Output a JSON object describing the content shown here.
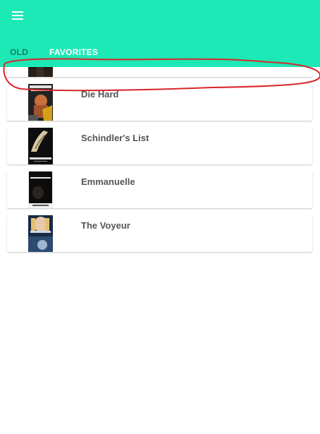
{
  "appbar": {
    "color": "#1de9b6",
    "menu_icon": "hamburger-menu-icon",
    "tabs": [
      {
        "label": "OLD",
        "selected": false
      },
      {
        "label": "FAVORITES",
        "selected": true
      }
    ]
  },
  "movies": [
    {
      "title": ""
    },
    {
      "title": "Die Hard"
    },
    {
      "title": "Schindler's List"
    },
    {
      "title": "Emmanuelle"
    },
    {
      "title": "The Voyeur"
    }
  ],
  "annotation": {
    "color": "#d9262c"
  }
}
